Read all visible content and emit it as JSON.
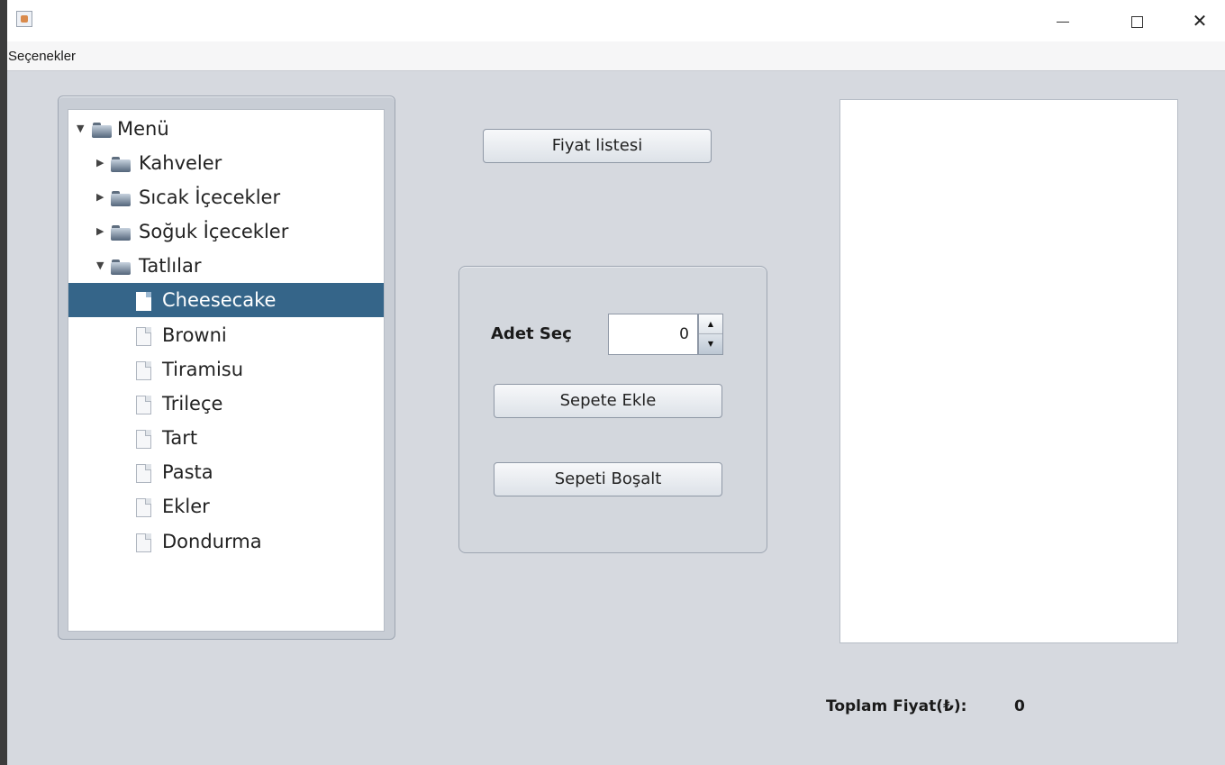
{
  "window": {
    "icon": "java-app-icon",
    "controls": {
      "minimize": "—",
      "maximize": "□",
      "close": "✕"
    }
  },
  "menubar": {
    "items": [
      "Seçenekler"
    ]
  },
  "tree": {
    "items": [
      {
        "label": "Menü",
        "icon": "folder-open-icon",
        "expanded": true,
        "selected": false
      },
      {
        "label": "Kahveler",
        "icon": "folder-icon",
        "expanded": false,
        "selected": false
      },
      {
        "label": "Sıcak İçecekler",
        "icon": "folder-icon",
        "expanded": false,
        "selected": false
      },
      {
        "label": "Soğuk İçecekler",
        "icon": "folder-icon",
        "expanded": false,
        "selected": false
      },
      {
        "label": "Tatlılar",
        "icon": "folder-open-icon",
        "expanded": true,
        "selected": false
      },
      {
        "label": "Cheesecake",
        "icon": "file-icon",
        "selected": true
      },
      {
        "label": "Browni",
        "icon": "file-icon",
        "selected": false
      },
      {
        "label": "Tiramisu",
        "icon": "file-icon",
        "selected": false
      },
      {
        "label": "Trileçe",
        "icon": "file-icon",
        "selected": false
      },
      {
        "label": "Tart",
        "icon": "file-icon",
        "selected": false
      },
      {
        "label": "Pasta",
        "icon": "file-icon",
        "selected": false
      },
      {
        "label": "Ekler",
        "icon": "file-icon",
        "selected": false
      },
      {
        "label": "Dondurma",
        "icon": "file-icon",
        "selected": false
      }
    ]
  },
  "buttons": {
    "price_list": "Fiyat listesi",
    "add_to_cart": "Sepete Ekle",
    "empty_cart": "Sepeti Boşalt"
  },
  "quantity": {
    "label": "Adet Seç",
    "value": "0"
  },
  "total": {
    "label": "Toplam Fiyat(₺):",
    "value": "0"
  },
  "colors": {
    "selection": "#356589",
    "window_bg": "#d6d9df"
  }
}
